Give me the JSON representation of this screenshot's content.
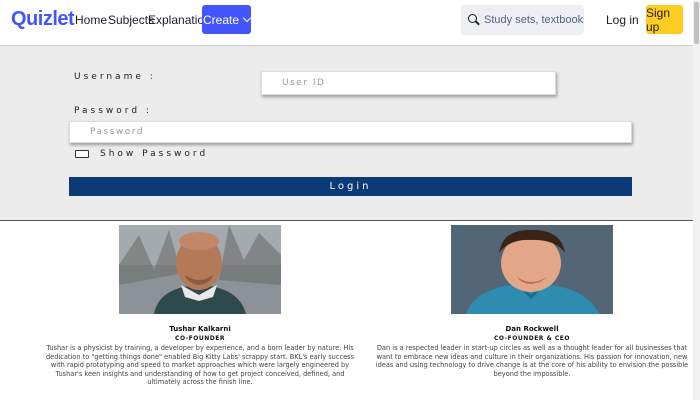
{
  "nav": {
    "logo": "Quizlet",
    "links": [
      "Home",
      "Subjects",
      "Explanations"
    ],
    "create_label": "Create",
    "search_placeholder": "Study sets, textbooks, ...",
    "login_label": "Log in",
    "signup_label": "Sign up"
  },
  "login_form": {
    "username_label": "Username :",
    "username_placeholder": "User ID",
    "password_label": "Password :",
    "password_placeholder": "Password",
    "show_password_label": "Show Password",
    "login_button": "Login"
  },
  "founders": [
    {
      "name": "Tushar Kalkarni",
      "role": "CO-FOUNDER",
      "bio": "Tushar is a physicist by training, a developer by experience, and a born leader by nature. His dedication to \"getting things done\" enabled Big Kitty Labs' scrappy start. BKL's early success with rapid prototyping and speed to market approaches which were largely engineered by Tushar's keen insights and understanding of how to get project conceived, defined, and ultimately across the finish line."
    },
    {
      "name": "Dan Rockwell",
      "role": "CO-FOUNDER & CEO",
      "bio": "Dan is a respected leader in start-up circles as well as a thought leader for all businesses that want to embrace new ideas and culture in their organizations. His passion for innovation, new ideas and using technology to drive change is at the core of his ability to envision the possible beyond the impossible."
    }
  ],
  "colors": {
    "brand": "#4255ff",
    "signup": "#ffcd1f",
    "login_button": "#0c3a78",
    "panel_bg": "#ececec"
  }
}
